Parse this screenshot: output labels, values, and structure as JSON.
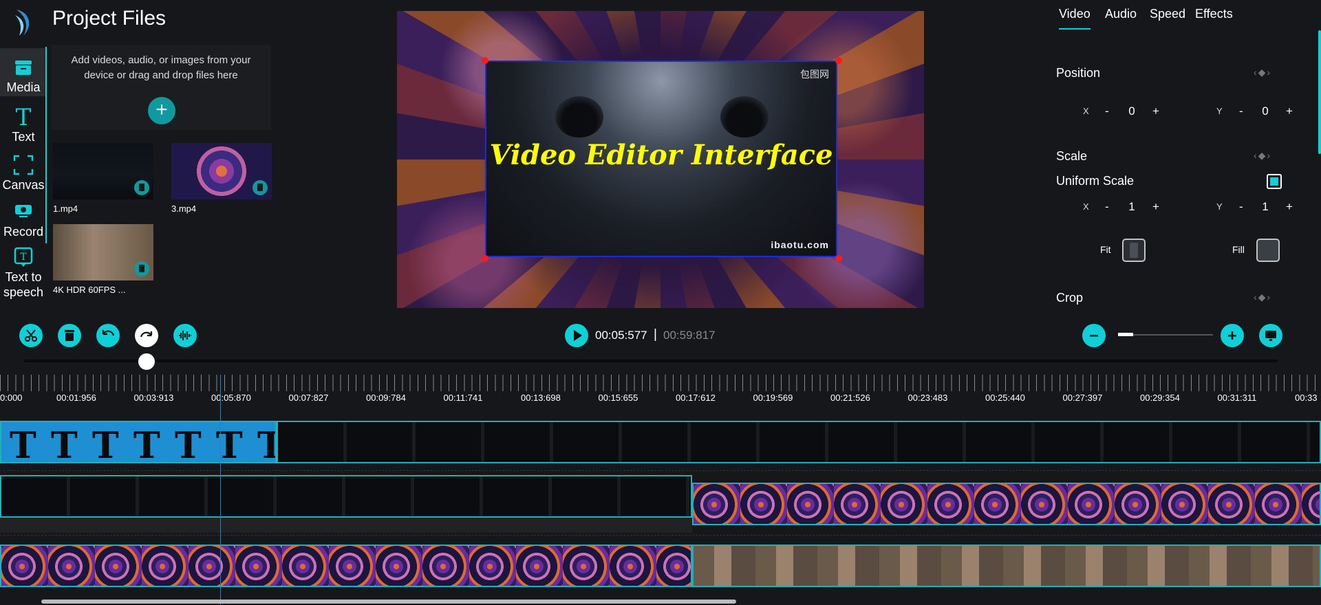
{
  "project": {
    "title": "Project Files",
    "drop_text": "Add videos, audio, or images from your device or drag and drop files here",
    "add_symbol": "+"
  },
  "rail": [
    {
      "label": "Media",
      "icon": "media-icon"
    },
    {
      "label": "Text",
      "icon": "text-icon"
    },
    {
      "label": "Canvas",
      "icon": "canvas-icon"
    },
    {
      "label": "Record",
      "icon": "record-icon"
    },
    {
      "label": "Text to speech",
      "icon": "text-to-speech-icon"
    }
  ],
  "files": [
    {
      "name": "1.mp4"
    },
    {
      "name": "3.mp4"
    },
    {
      "name": "4K HDR 60FPS ..."
    }
  ],
  "preview": {
    "title": "Video Editor Interface",
    "watermark_top": "包图网",
    "watermark_bottom": "ibaotu.com"
  },
  "panel": {
    "tabs": [
      "Video",
      "Audio",
      "Speed",
      "Effects"
    ],
    "position_label": "Position",
    "scale_label": "Scale",
    "uniform_scale_label": "Uniform Scale",
    "crop_label": "Crop",
    "x_label": "X",
    "y_label": "Y",
    "minus": "-",
    "plus": "+",
    "pos_x": "0",
    "pos_y": "0",
    "scale_x": "1",
    "scale_y": "1",
    "fit_label": "Fit",
    "fill_label": "Fill",
    "keyframe_glyph": "‹◆›",
    "uniform_scale_checked": true
  },
  "playback": {
    "current": "00:05:577",
    "separator": "|",
    "total": "00:59:817"
  },
  "timeline": {
    "ticks": [
      "0:000",
      "00:01:956",
      "00:03:913",
      "00:05:870",
      "00:07:827",
      "00:09:784",
      "00:11:741",
      "00:13:698",
      "00:15:655",
      "00:17:612",
      "00:19:569",
      "00:21:526",
      "00:23:483",
      "00:25:440",
      "00:27:397",
      "00:29:354",
      "00:31:311",
      "00:33"
    ],
    "text_clip_glyph": "T"
  },
  "colors": {
    "accent": "#0fd0d6",
    "text_clip": "#1d8fd2",
    "title_yellow": "#ffff00",
    "handle_red": "#ff1a1a"
  }
}
